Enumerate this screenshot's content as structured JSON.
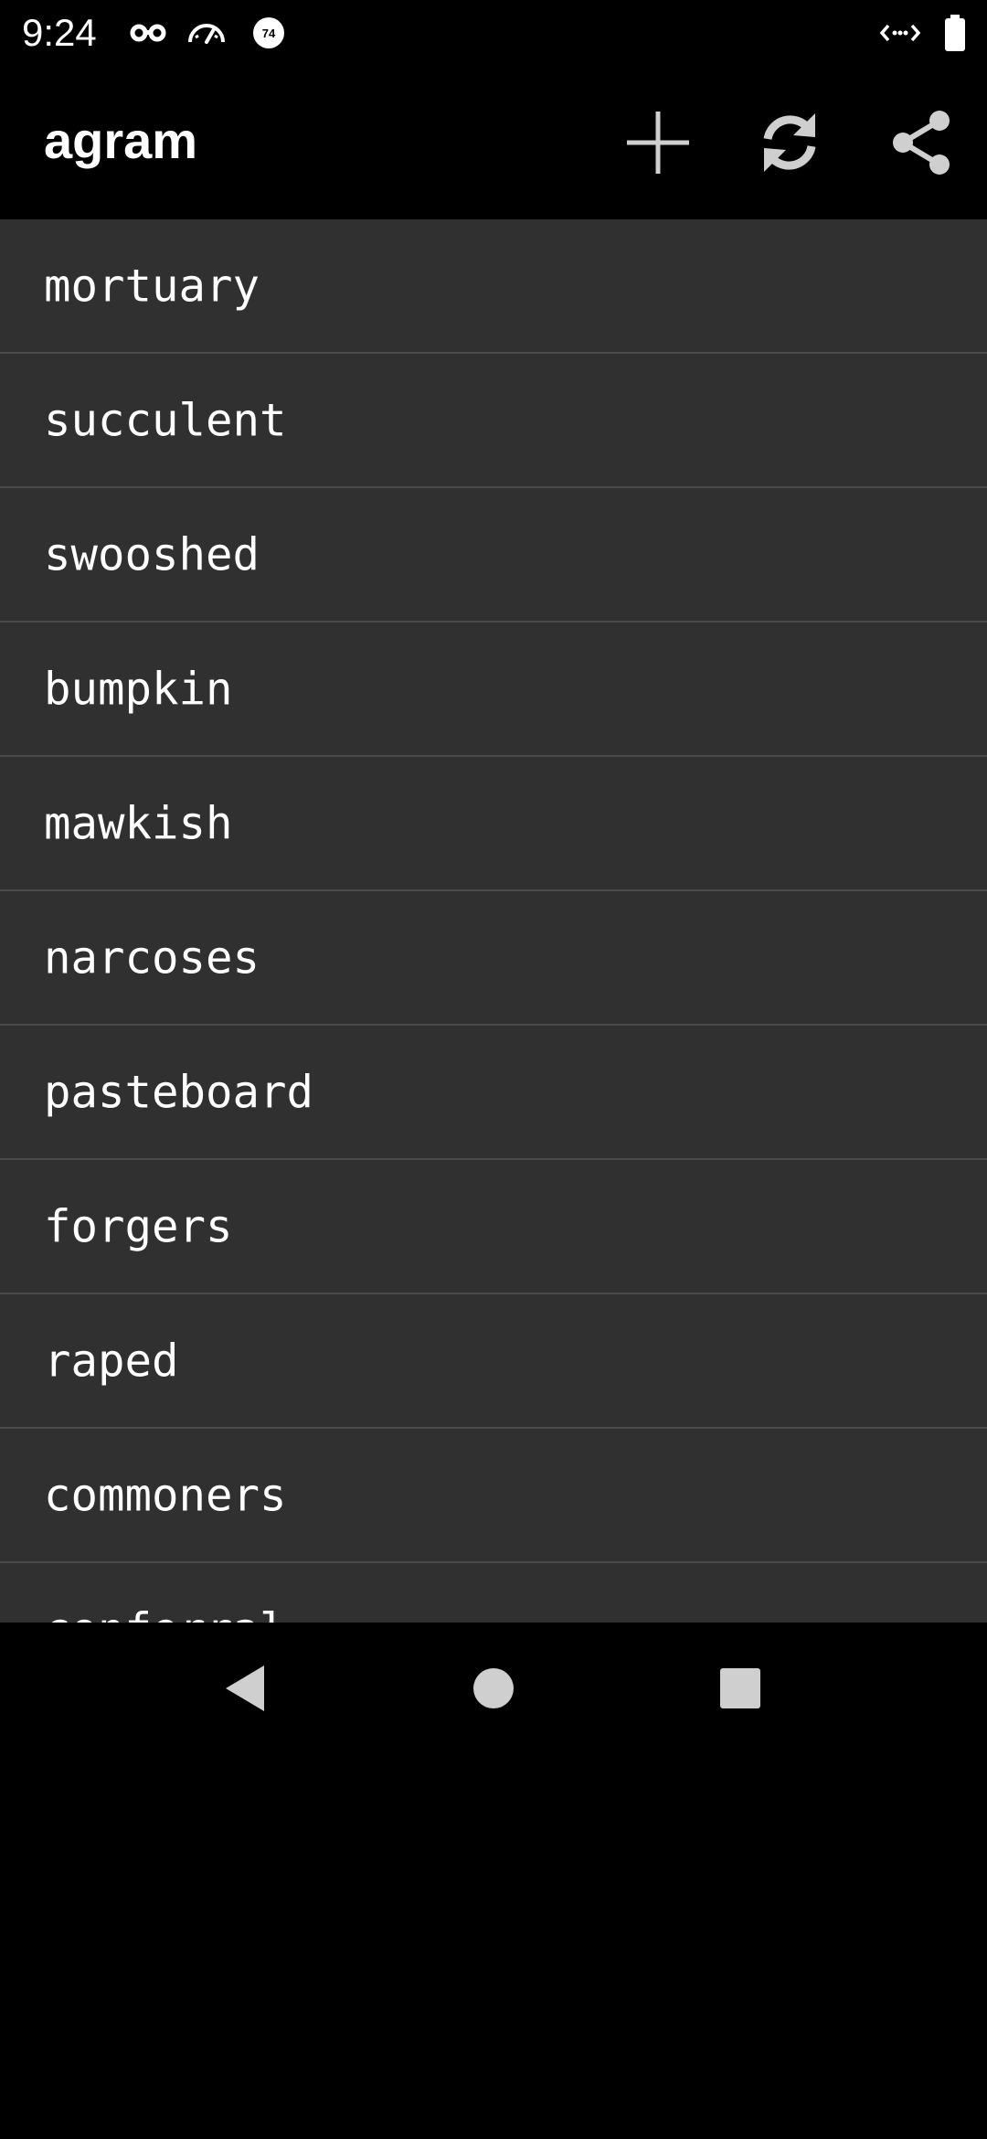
{
  "status_bar": {
    "time": "9:24",
    "icons_left": [
      "incognito-icon",
      "speedometer-icon",
      "badge-74-icon"
    ],
    "badge_number": "74",
    "icons_right": [
      "data-transfer-icon",
      "battery-icon"
    ]
  },
  "app_bar": {
    "title": "agram",
    "actions": [
      "add-icon",
      "refresh-icon",
      "share-icon"
    ]
  },
  "list": {
    "items": [
      {
        "label": "mortuary"
      },
      {
        "label": "succulent"
      },
      {
        "label": "swooshed"
      },
      {
        "label": "bumpkin"
      },
      {
        "label": "mawkish"
      },
      {
        "label": "narcoses"
      },
      {
        "label": "pasteboard"
      },
      {
        "label": "forgers"
      },
      {
        "label": "raped"
      },
      {
        "label": "commoners"
      },
      {
        "label": "conferral"
      }
    ]
  },
  "nav_bar": {
    "buttons": [
      "back-icon",
      "home-icon",
      "recents-icon"
    ]
  },
  "colors": {
    "background": "#000000",
    "list_background": "#303030",
    "divider": "#4a4a4a",
    "text": "#ffffff",
    "icon": "#cfcfcf"
  }
}
